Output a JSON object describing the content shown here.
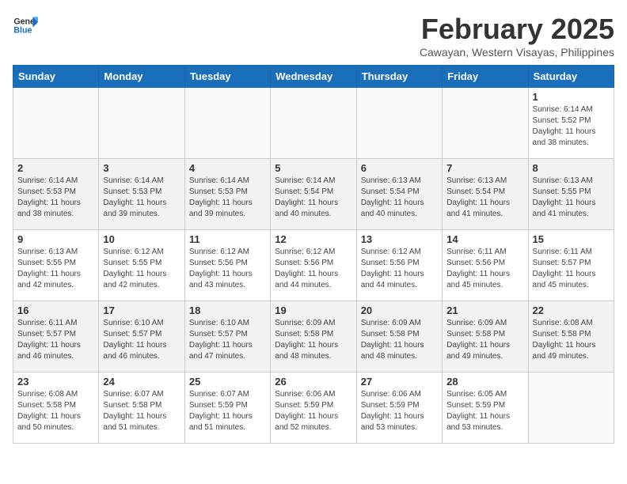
{
  "header": {
    "logo_line1": "General",
    "logo_line2": "Blue",
    "month": "February 2025",
    "location": "Cawayan, Western Visayas, Philippines"
  },
  "weekdays": [
    "Sunday",
    "Monday",
    "Tuesday",
    "Wednesday",
    "Thursday",
    "Friday",
    "Saturday"
  ],
  "weeks": [
    [
      {
        "day": "",
        "info": ""
      },
      {
        "day": "",
        "info": ""
      },
      {
        "day": "",
        "info": ""
      },
      {
        "day": "",
        "info": ""
      },
      {
        "day": "",
        "info": ""
      },
      {
        "day": "",
        "info": ""
      },
      {
        "day": "1",
        "info": "Sunrise: 6:14 AM\nSunset: 5:52 PM\nDaylight: 11 hours\nand 38 minutes."
      }
    ],
    [
      {
        "day": "2",
        "info": "Sunrise: 6:14 AM\nSunset: 5:53 PM\nDaylight: 11 hours\nand 38 minutes."
      },
      {
        "day": "3",
        "info": "Sunrise: 6:14 AM\nSunset: 5:53 PM\nDaylight: 11 hours\nand 39 minutes."
      },
      {
        "day": "4",
        "info": "Sunrise: 6:14 AM\nSunset: 5:53 PM\nDaylight: 11 hours\nand 39 minutes."
      },
      {
        "day": "5",
        "info": "Sunrise: 6:14 AM\nSunset: 5:54 PM\nDaylight: 11 hours\nand 40 minutes."
      },
      {
        "day": "6",
        "info": "Sunrise: 6:13 AM\nSunset: 5:54 PM\nDaylight: 11 hours\nand 40 minutes."
      },
      {
        "day": "7",
        "info": "Sunrise: 6:13 AM\nSunset: 5:54 PM\nDaylight: 11 hours\nand 41 minutes."
      },
      {
        "day": "8",
        "info": "Sunrise: 6:13 AM\nSunset: 5:55 PM\nDaylight: 11 hours\nand 41 minutes."
      }
    ],
    [
      {
        "day": "9",
        "info": "Sunrise: 6:13 AM\nSunset: 5:55 PM\nDaylight: 11 hours\nand 42 minutes."
      },
      {
        "day": "10",
        "info": "Sunrise: 6:12 AM\nSunset: 5:55 PM\nDaylight: 11 hours\nand 42 minutes."
      },
      {
        "day": "11",
        "info": "Sunrise: 6:12 AM\nSunset: 5:56 PM\nDaylight: 11 hours\nand 43 minutes."
      },
      {
        "day": "12",
        "info": "Sunrise: 6:12 AM\nSunset: 5:56 PM\nDaylight: 11 hours\nand 44 minutes."
      },
      {
        "day": "13",
        "info": "Sunrise: 6:12 AM\nSunset: 5:56 PM\nDaylight: 11 hours\nand 44 minutes."
      },
      {
        "day": "14",
        "info": "Sunrise: 6:11 AM\nSunset: 5:56 PM\nDaylight: 11 hours\nand 45 minutes."
      },
      {
        "day": "15",
        "info": "Sunrise: 6:11 AM\nSunset: 5:57 PM\nDaylight: 11 hours\nand 45 minutes."
      }
    ],
    [
      {
        "day": "16",
        "info": "Sunrise: 6:11 AM\nSunset: 5:57 PM\nDaylight: 11 hours\nand 46 minutes."
      },
      {
        "day": "17",
        "info": "Sunrise: 6:10 AM\nSunset: 5:57 PM\nDaylight: 11 hours\nand 46 minutes."
      },
      {
        "day": "18",
        "info": "Sunrise: 6:10 AM\nSunset: 5:57 PM\nDaylight: 11 hours\nand 47 minutes."
      },
      {
        "day": "19",
        "info": "Sunrise: 6:09 AM\nSunset: 5:58 PM\nDaylight: 11 hours\nand 48 minutes."
      },
      {
        "day": "20",
        "info": "Sunrise: 6:09 AM\nSunset: 5:58 PM\nDaylight: 11 hours\nand 48 minutes."
      },
      {
        "day": "21",
        "info": "Sunrise: 6:09 AM\nSunset: 5:58 PM\nDaylight: 11 hours\nand 49 minutes."
      },
      {
        "day": "22",
        "info": "Sunrise: 6:08 AM\nSunset: 5:58 PM\nDaylight: 11 hours\nand 49 minutes."
      }
    ],
    [
      {
        "day": "23",
        "info": "Sunrise: 6:08 AM\nSunset: 5:58 PM\nDaylight: 11 hours\nand 50 minutes."
      },
      {
        "day": "24",
        "info": "Sunrise: 6:07 AM\nSunset: 5:58 PM\nDaylight: 11 hours\nand 51 minutes."
      },
      {
        "day": "25",
        "info": "Sunrise: 6:07 AM\nSunset: 5:59 PM\nDaylight: 11 hours\nand 51 minutes."
      },
      {
        "day": "26",
        "info": "Sunrise: 6:06 AM\nSunset: 5:59 PM\nDaylight: 11 hours\nand 52 minutes."
      },
      {
        "day": "27",
        "info": "Sunrise: 6:06 AM\nSunset: 5:59 PM\nDaylight: 11 hours\nand 53 minutes."
      },
      {
        "day": "28",
        "info": "Sunrise: 6:05 AM\nSunset: 5:59 PM\nDaylight: 11 hours\nand 53 minutes."
      },
      {
        "day": "",
        "info": ""
      }
    ]
  ]
}
